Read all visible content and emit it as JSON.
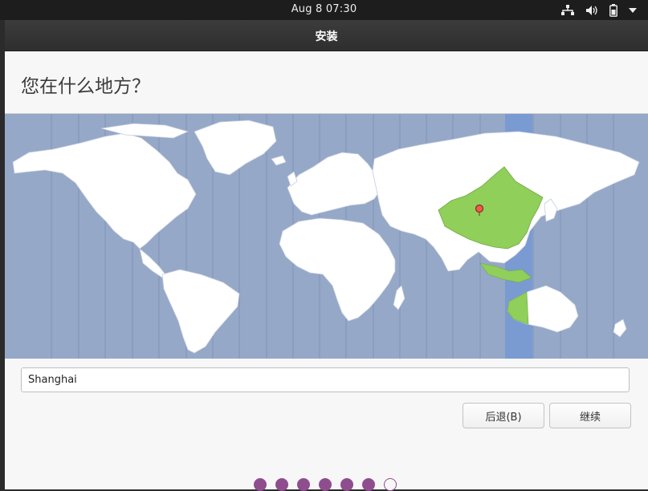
{
  "top_bar": {
    "clock": "Aug 8  07:30",
    "icons": [
      "network-icon",
      "volume-icon",
      "battery-icon",
      "system-menu-chevron-icon"
    ]
  },
  "window": {
    "title": "安装"
  },
  "page": {
    "heading": "您在什么地方？"
  },
  "map": {
    "selected_zone_color": "#7a9ad2",
    "selected_country_color": "#8fcf5a",
    "land_color": "#ffffff",
    "water_color": "#95a8c8",
    "marker_icon": "location-pin-icon"
  },
  "location": {
    "value": "Shanghai"
  },
  "buttons": {
    "back_label": "后退(B)",
    "next_label": "继续"
  },
  "progress": {
    "total_steps": 7,
    "completed_steps": 6,
    "accent_color": "#8e4e8e"
  }
}
